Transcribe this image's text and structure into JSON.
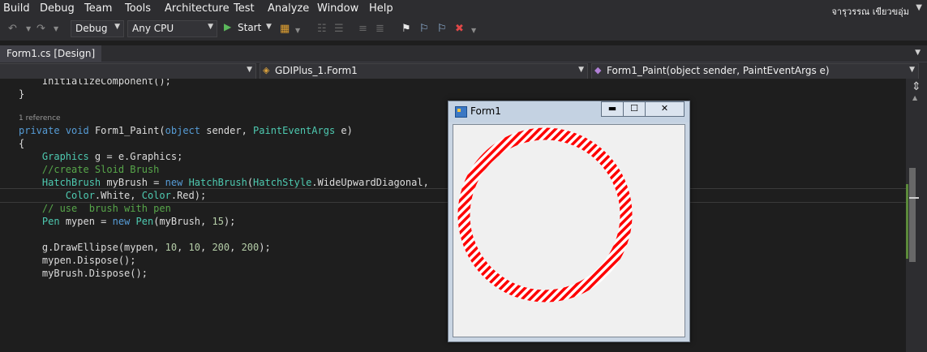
{
  "menu": {
    "items": [
      "Build",
      "Debug",
      "Team",
      "Tools",
      "Architecture",
      "Test",
      "Analyze",
      "Window",
      "Help"
    ],
    "user_name": "จารุวรรณ เขียวขอุ่ม"
  },
  "toolbar": {
    "config_value": "Debug",
    "platform_value": "Any CPU",
    "start_label": "Start"
  },
  "tabs": {
    "active_tab": "Form1.cs [Design]"
  },
  "navbar": {
    "project_combo": "",
    "class_combo": "GDIPlus_1.Form1",
    "member_combo": "Form1_Paint(object sender, PaintEventArgs e)"
  },
  "editor": {
    "codelens_text": "1 reference",
    "lines": [
      "    InitializeComponent();",
      "}",
      "private void Form1_Paint(object sender, PaintEventArgs e)",
      "{",
      "    Graphics g = e.Graphics;",
      "    //create Sloid Brush",
      "    HatchBrush myBrush = new HatchBrush(HatchStyle.WideUpwardDiagonal,",
      "        Color.White, Color.Red);",
      "    // use  brush with pen",
      "    Pen mypen = new Pen(myBrush, 15);",
      "",
      "    g.DrawEllipse(mypen, 10, 10, 200, 200);",
      "    mypen.Dispose();",
      "    myBrush.Dispose();"
    ]
  },
  "form_window": {
    "title": "Form1",
    "minimize_glyph": "▬",
    "maximize_glyph": "☐",
    "close_glyph": "✕",
    "ellipse_pen_color": "#ff0000",
    "ellipse_hatch_back": "#ffffff"
  },
  "colors": {
    "background": "#1e1e1e",
    "chrome": "#2d2d30",
    "keyword": "#569cd6",
    "type": "#4ec9b0",
    "comment": "#57a64a",
    "number": "#b5cea8"
  }
}
